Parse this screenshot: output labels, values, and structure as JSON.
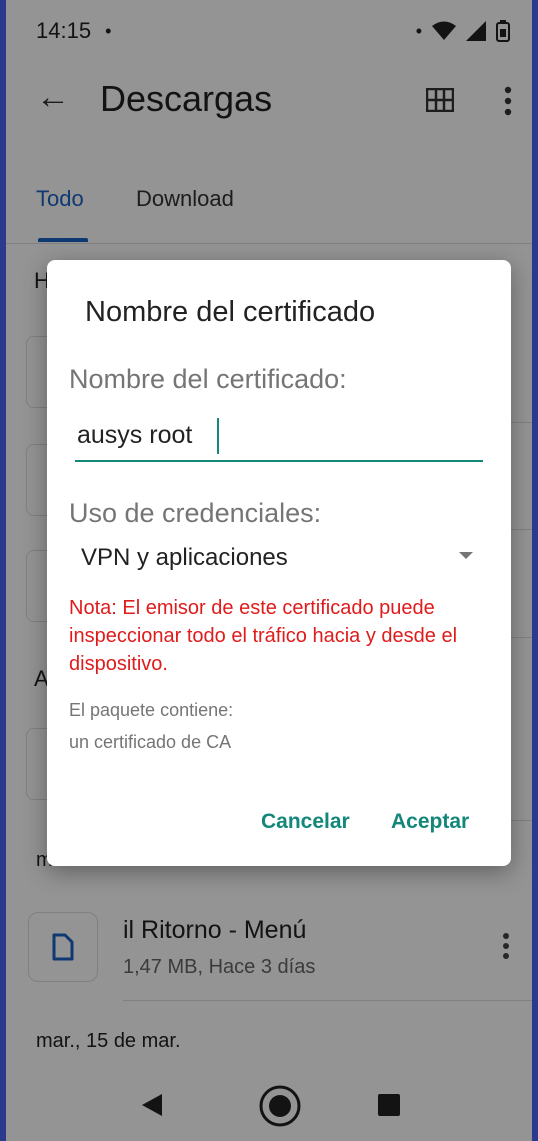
{
  "status_bar": {
    "time": "14:15",
    "left_dot": "•",
    "right_dot": "•"
  },
  "toolbar": {
    "back_icon": "arrow-back-icon",
    "title": "Descargas",
    "grid_icon": "grid-view-icon",
    "more_icon": "more-vertical-icon"
  },
  "tabs": [
    {
      "label": "Todo",
      "active": true
    },
    {
      "label": "Download",
      "active": false
    }
  ],
  "background": {
    "partial_letters": [
      "H",
      "A"
    ],
    "month_partial": "m",
    "file": {
      "name": "il Ritorno - Menú",
      "meta": "1,47 MB, Hace 3 días",
      "icon": "document-icon"
    },
    "date_header": "mar., 15 de mar."
  },
  "dialog": {
    "title": "Nombre del certificado",
    "name_label": "Nombre del certificado:",
    "name_value": "ausys root",
    "usage_label": "Uso de credenciales:",
    "usage_value": "VPN y aplicaciones",
    "warning": "Nota: El emisor de este certificado puede inspeccionar todo el tráfico hacia y desde el dispositivo.",
    "package_label": "El paquete contiene:",
    "package_value": "un certificado de CA",
    "cancel_label": "Cancelar",
    "accept_label": "Aceptar"
  },
  "colors": {
    "accent": "#14877b",
    "tab_active": "#1a63c6",
    "warning": "#e01b1b",
    "frame": "#2b3a8c"
  }
}
